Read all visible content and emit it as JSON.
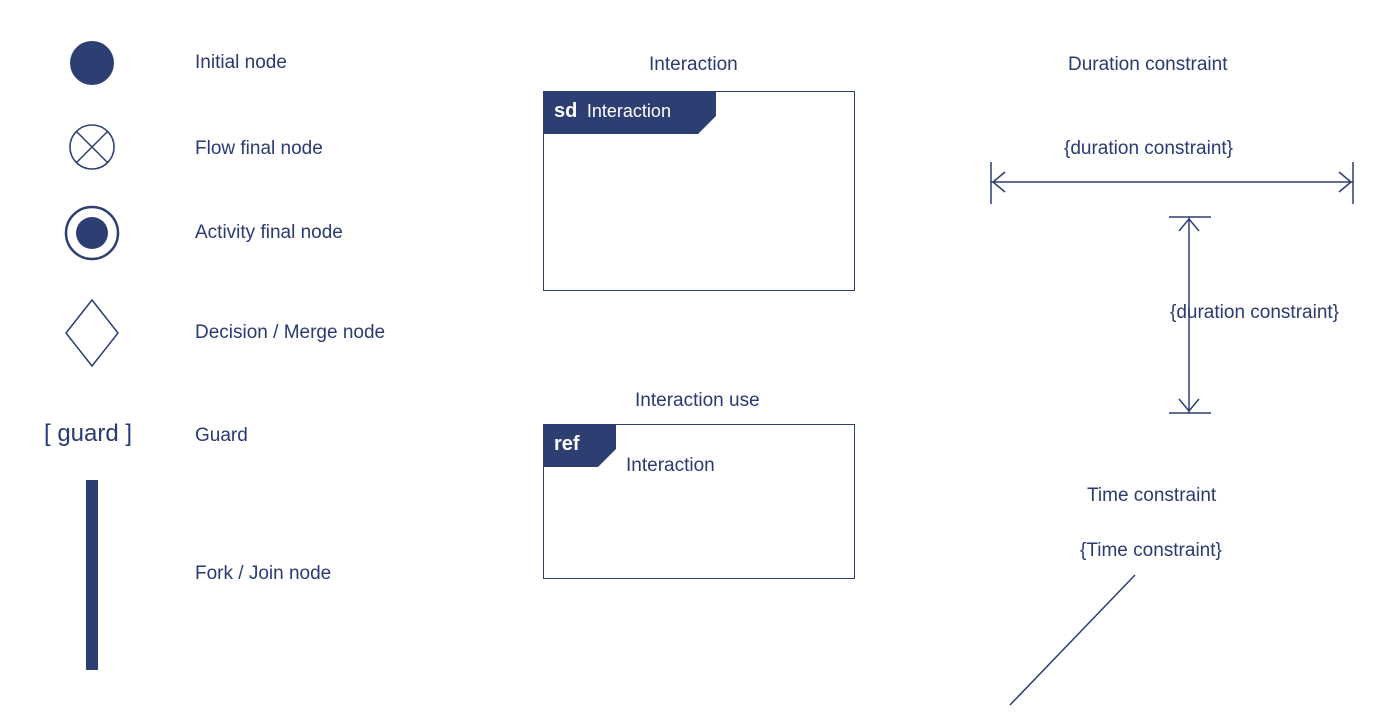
{
  "left": {
    "initial": "Initial node",
    "flowFinal": "Flow final node",
    "activityFinal": "Activity final node",
    "decision": "Decision / Merge node",
    "guardSymbol": "[ guard ]",
    "guardLabel": "Guard",
    "forkJoin": "Fork / Join node"
  },
  "center": {
    "interactionTitle": "Interaction",
    "sdTagPrefix": "sd",
    "sdTagText": "Interaction",
    "interactionUseTitle": "Interaction use",
    "refTag": "ref",
    "refText": "Interaction"
  },
  "right": {
    "durationTitle": "Duration constraint",
    "durationHoriz": "{duration constraint}",
    "durationVert": "{duration constraint}",
    "timeTitle": "Time constraint",
    "timeText": "{Time constraint}"
  }
}
